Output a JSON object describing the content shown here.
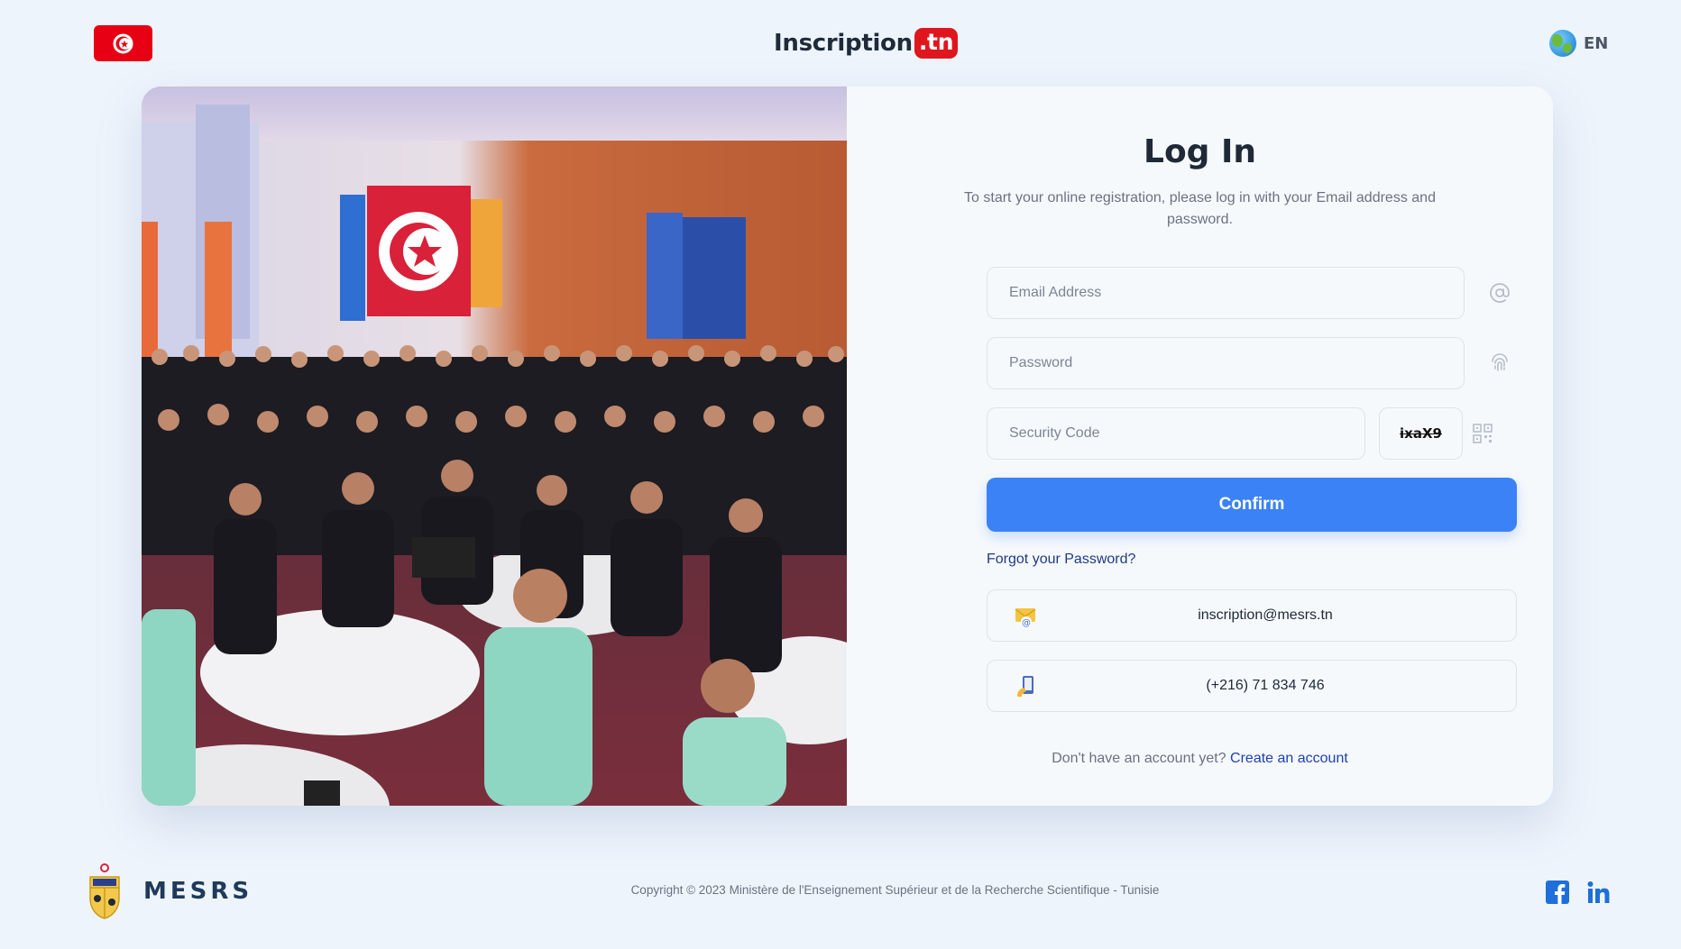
{
  "header": {
    "flag_label": "Tunisia flag",
    "brand_main": "Inscription",
    "brand_suffix": ".tn",
    "language": "EN"
  },
  "login": {
    "title": "Log In",
    "subtitle": "To start your online registration, please log in with your Email address and password.",
    "email_placeholder": "Email Address",
    "password_placeholder": "Password",
    "security_placeholder": "Security Code",
    "captcha_text": "ixaX9",
    "confirm_label": "Confirm",
    "forgot_label": "Forgot your Password?",
    "contact_email": "inscription@mesrs.tn",
    "contact_phone": "(+216) 71 834 746",
    "no_account_text": "Don't have an account yet?",
    "create_account_label": "Create an account"
  },
  "footer": {
    "org_name": "MESRS",
    "copyright": "Copyright © 2023 Ministère de l'Enseignement Supérieur et de la Recherche Scientifique - Tunisie"
  },
  "colors": {
    "background": "#eef4fc",
    "primary": "#3b82f6",
    "brand_red": "#e0161e",
    "link": "#1e40af"
  },
  "icons": [
    "tunisia-flag-icon",
    "globe-icon",
    "at-sign-icon",
    "fingerprint-icon",
    "qr-code-icon",
    "mail-icon",
    "phone-icon",
    "facebook-icon",
    "linkedin-icon"
  ]
}
